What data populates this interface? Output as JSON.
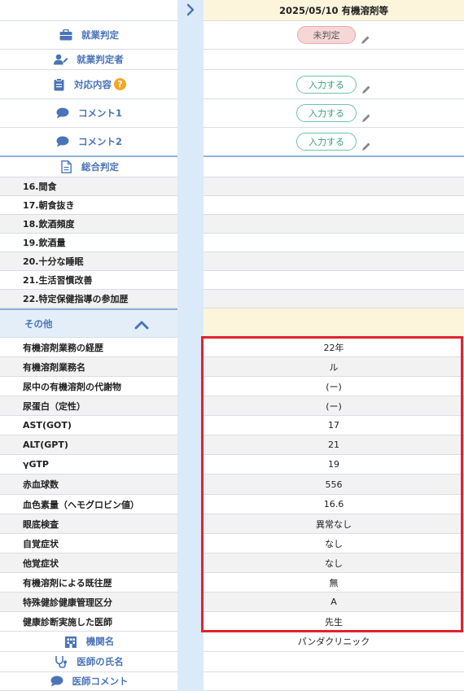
{
  "column": {
    "header": "2025/05/10 有機溶剤等"
  },
  "judgement": {
    "work_judgement_label": "就業判定",
    "work_judgement_value": "未判定",
    "judge_person_label": "就業判定者",
    "response_label": "対応内容",
    "comment1_label": "コメント1",
    "comment2_label": "コメント2",
    "input_button": "入力する"
  },
  "overall": {
    "title": "総合判定",
    "items": [
      "16.間食",
      "17.朝食抜き",
      "18.飲酒頻度",
      "19.飲酒量",
      "20.十分な睡眠",
      "21.生活習慣改善",
      "22.特定保健指導の参加歴"
    ]
  },
  "other": {
    "title": "その他",
    "rows": [
      {
        "label": "有機溶剤業務の経歴",
        "value": "22年"
      },
      {
        "label": "有機溶剤業務名",
        "value": "ル"
      },
      {
        "label": "尿中の有機溶剤の代謝物",
        "value": "(ー)"
      },
      {
        "label": "尿蛋白（定性）",
        "value": "(ー)"
      },
      {
        "label": "AST(GOT)",
        "value": "17"
      },
      {
        "label": "ALT(GPT)",
        "value": "21"
      },
      {
        "label": "γGTP",
        "value": "19"
      },
      {
        "label": "赤血球数",
        "value": "556"
      },
      {
        "label": "血色素量（ヘモグロビン値）",
        "value": "16.6"
      },
      {
        "label": "眼底検査",
        "value": "異常なし"
      },
      {
        "label": "自覚症状",
        "value": "なし"
      },
      {
        "label": "他覚症状",
        "value": "なし"
      },
      {
        "label": "有機溶剤による既往歴",
        "value": "無"
      },
      {
        "label": "特殊健診健康管理区分",
        "value": "A"
      },
      {
        "label": "健康診断実施した医師",
        "value": "先生"
      }
    ]
  },
  "institution": {
    "name_label": "機関名",
    "name_value": "パンダクリニック",
    "doctor_label": "医師の氏名",
    "comment_label": "医師コメント"
  },
  "colors": {
    "accent_blue": "#4a74b8",
    "help_orange": "#f5a623",
    "highlight_red": "#e0232e",
    "pill_green": "#6cc3a6"
  }
}
